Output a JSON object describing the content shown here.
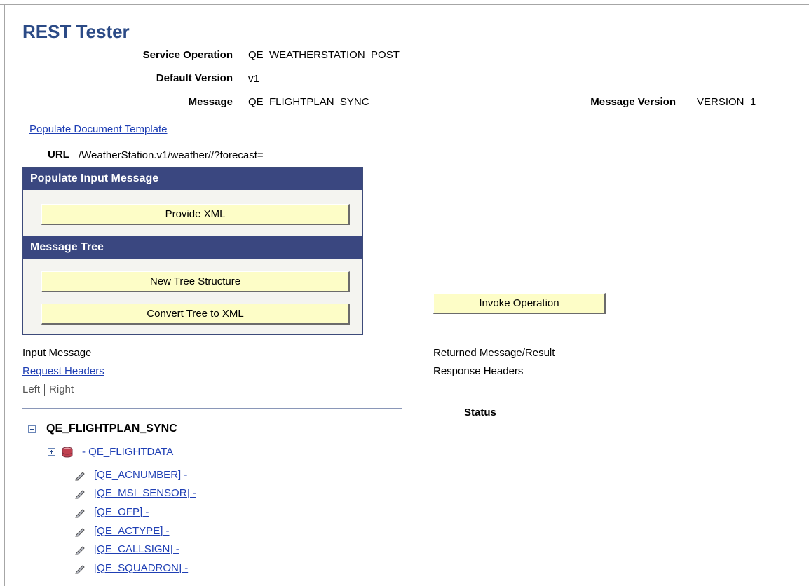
{
  "page": {
    "title": "REST Tester"
  },
  "fields": {
    "service_operation": {
      "label": "Service Operation",
      "value": "QE_WEATHERSTATION_POST"
    },
    "default_version": {
      "label": "Default Version",
      "value": "v1"
    },
    "message": {
      "label": "Message",
      "value": "QE_FLIGHTPLAN_SYNC"
    },
    "message_version": {
      "label": "Message Version",
      "value": "VERSION_1"
    }
  },
  "links": {
    "populate_template": "Populate Document Template"
  },
  "url": {
    "label": "URL",
    "value": "/WeatherStation.v1/weather//?forecast="
  },
  "panel": {
    "populate_input_header": "Populate Input Message",
    "provide_xml_label": "Provide XML",
    "message_tree_header": "Message Tree",
    "new_tree_label": "New Tree Structure",
    "convert_tree_label": "Convert Tree to XML"
  },
  "invoke_label": "Invoke Operation",
  "left_column": {
    "input_message": "Input Message",
    "request_headers": "Request Headers",
    "left_label": "Left",
    "right_label": "Right"
  },
  "right_column": {
    "returned_message": "Returned Message/Result",
    "response_headers": "Response Headers",
    "status_label": "Status"
  },
  "tree": {
    "root": "QE_FLIGHTPLAN_SYNC",
    "record": "- QE_FLIGHTDATA",
    "fields": [
      "[QE_ACNUMBER] -",
      "[QE_MSI_SENSOR] -",
      "[QE_OFP] -",
      "[QE_ACTYPE] -",
      "[QE_CALLSIGN] -",
      "[QE_SQUADRON] -"
    ]
  },
  "icons": {
    "expand": "plus-box-icon",
    "record": "database-icon",
    "field": "pencil-icon"
  }
}
